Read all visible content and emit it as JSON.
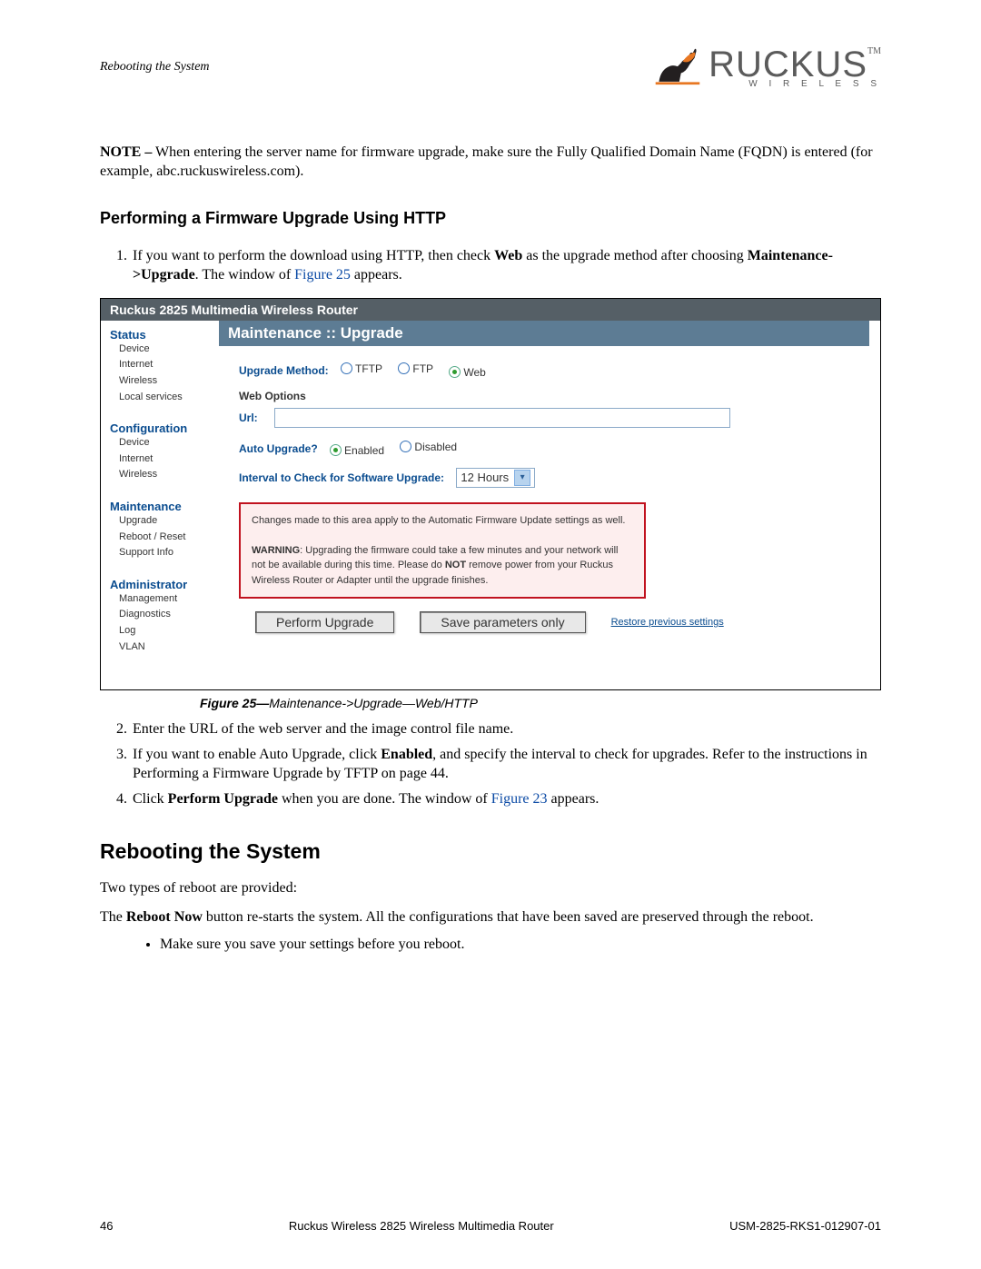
{
  "header": {
    "running_head": "Rebooting the System",
    "logo_word": "RUCKUS",
    "logo_sub": "W I R E L E S S",
    "logo_tm": "TM"
  },
  "note": {
    "label": "NOTE –",
    "text": " When entering the server name for firmware upgrade, make sure the Fully Qualified Domain Name (FQDN) is entered (for example, abc.ruckuswireless.com)."
  },
  "subsection_title": "Performing a Firmware Upgrade Using HTTP",
  "step1": {
    "num": "1.",
    "pre": "If you want to perform the download using HTTP, then check ",
    "b1": "Web",
    "mid": " as the upgrade method after choosing ",
    "b2": "Maintenance->Upgrade",
    "post": ". The window of ",
    "link": "Figure 25",
    "end": " appears."
  },
  "router": {
    "titlebar": "Ruckus 2825 Multimedia Wireless Router",
    "panel_head": "Maintenance :: Upgrade",
    "sidebar": {
      "status_head": "Status",
      "status_items": [
        "Device",
        "Internet",
        "Wireless",
        "Local services"
      ],
      "config_head": "Configuration",
      "config_items": [
        "Device",
        "Internet",
        "Wireless"
      ],
      "maint_head": "Maintenance",
      "maint_items": [
        "Upgrade",
        "Reboot / Reset",
        "Support Info"
      ],
      "admin_head": "Administrator",
      "admin_items": [
        "Management",
        "Diagnostics",
        "Log",
        "VLAN"
      ]
    },
    "upgrade_method_label": "Upgrade Method:",
    "methods": {
      "tftp": "TFTP",
      "ftp": "FTP",
      "web": "Web"
    },
    "web_options_label": "Web Options",
    "url_label": "Url:",
    "auto_upgrade_label": "Auto Upgrade?",
    "auto_enabled": "Enabled",
    "auto_disabled": "Disabled",
    "interval_label": "Interval to Check for Software Upgrade:",
    "interval_value": "12 Hours",
    "warning_line1": "Changes made to this area apply to the Automatic Firmware Update settings as well.",
    "warning_bold": "WARNING",
    "warning_rest": ": Upgrading the firmware could take a few minutes and your network will not be available during this time. Please do ",
    "warning_not": "NOT",
    "warning_rest2": " remove power from your Ruckus Wireless Router or Adapter until the upgrade finishes.",
    "btn_perform": "Perform Upgrade",
    "btn_save": "Save parameters only",
    "btn_restore": "Restore previous settings"
  },
  "fig_caption_b": "Figure 25—",
  "fig_caption_i": "Maintenance->Upgrade—Web/HTTP",
  "step2": {
    "num": "2.",
    "text": "Enter the URL of the web server and the image control file name."
  },
  "step3": {
    "num": "3.",
    "pre": "If you want to enable Auto Upgrade, click ",
    "b1": "Enabled",
    "post": ", and specify the interval to check for upgrades. Refer to the instructions in Performing a Firmware Upgrade by TFTP on page 44."
  },
  "step4": {
    "num": "4.",
    "pre": "Click ",
    "b1": "Perform Upgrade",
    "mid": " when you are done. The window of ",
    "link": "Figure 23",
    "end": " appears."
  },
  "section_title": "Rebooting the System",
  "para1": "Two types of reboot are provided:",
  "para2_pre": "The ",
  "para2_b": "Reboot Now",
  "para2_post": " button re-starts the system. All the configurations that have been saved are preserved through the reboot.",
  "bullet1": "Make sure you save your settings before you reboot.",
  "footer": {
    "page": "46",
    "center": "Ruckus Wireless 2825 Wireless Multimedia Router",
    "right": "USM-2825-RKS1-012907-01"
  }
}
